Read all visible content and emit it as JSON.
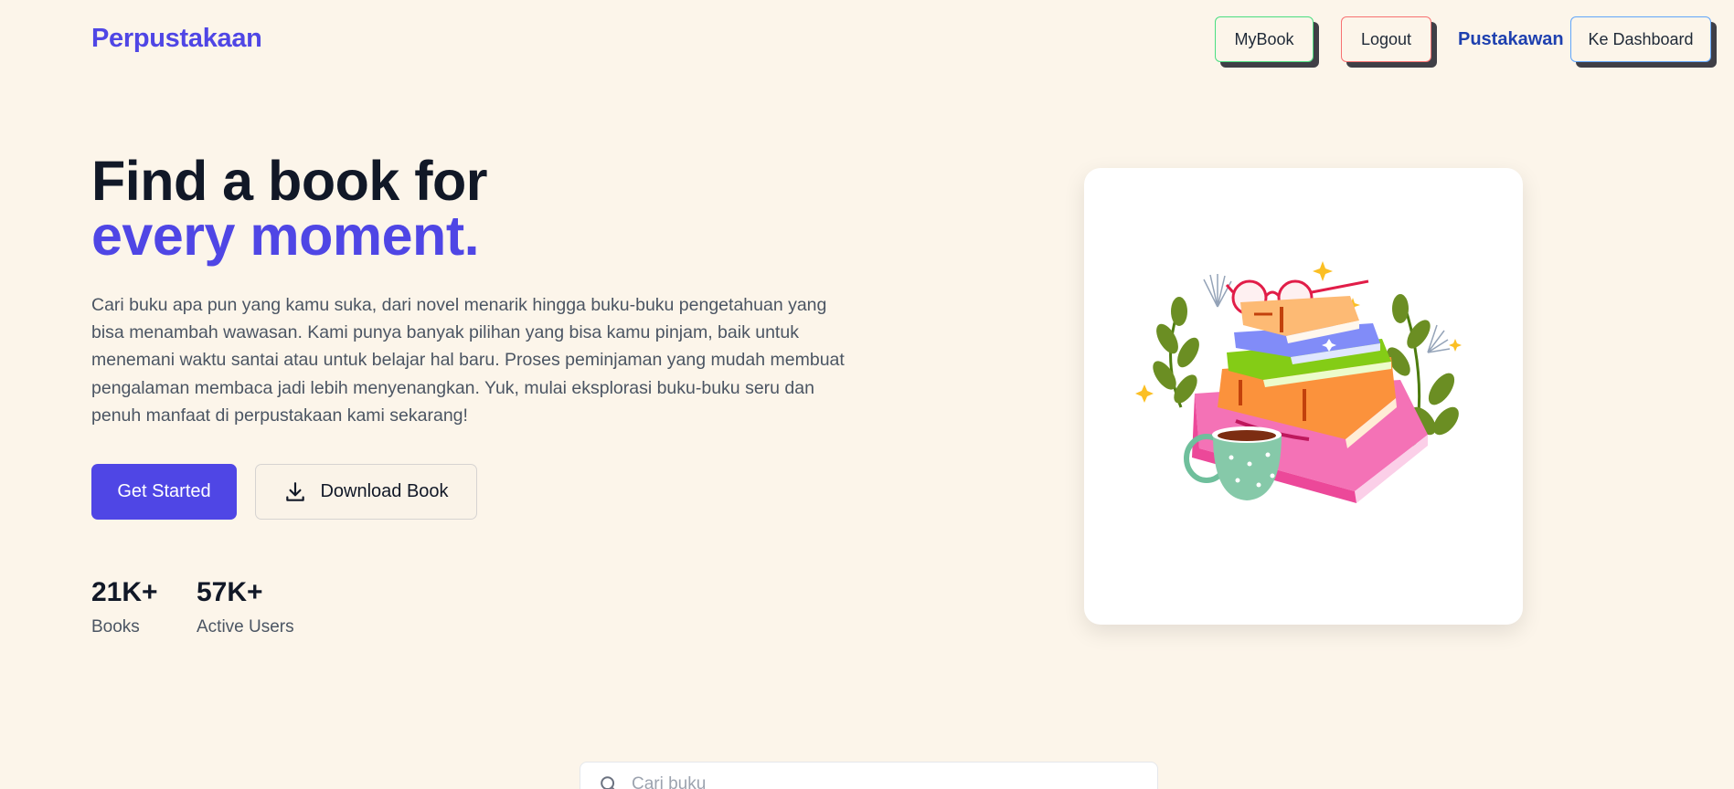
{
  "header": {
    "brand": "Perpustakaan",
    "nav": {
      "mybook": "MyBook",
      "logout": "Logout",
      "role": "Pustakawan",
      "dashboard": "Ke Dashboard"
    }
  },
  "hero": {
    "title_line1": "Find a book for",
    "title_line2": "every moment.",
    "description": "Cari buku apa pun yang kamu suka, dari novel menarik hingga buku-buku pengetahuan yang bisa menambah wawasan. Kami punya banyak pilihan yang bisa kamu pinjam, baik untuk menemani waktu santai atau untuk belajar hal baru. Proses peminjaman yang mudah membuat pengalaman membaca jadi lebih menyenangkan. Yuk, mulai eksplorasi buku-buku seru dan penuh manfaat di perpustakaan kami sekarang!",
    "get_started": "Get Started",
    "download_book": "Download Book",
    "stats": [
      {
        "value": "21K+",
        "label": "Books"
      },
      {
        "value": "57K+",
        "label": "Active Users"
      }
    ]
  },
  "search": {
    "placeholder": "Cari buku"
  },
  "colors": {
    "background": "#fcf5ea",
    "accent": "#4f46e5",
    "role": "#1e40af"
  },
  "icons": {
    "download": "download-icon",
    "search": "search-icon",
    "illustration": "book-stack-illustration"
  }
}
